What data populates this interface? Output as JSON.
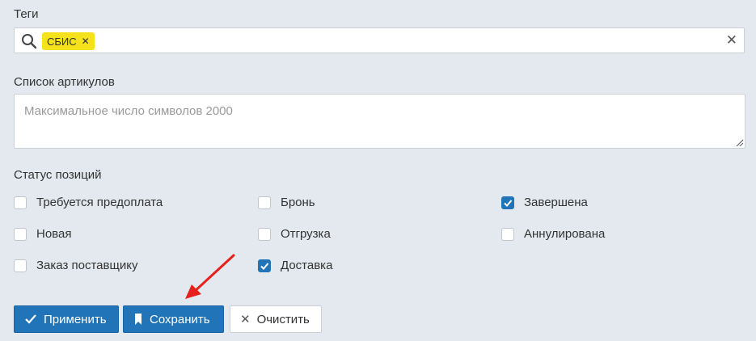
{
  "tags": {
    "label": "Теги",
    "chip": "СБИС",
    "chip_color": "#f5e21a"
  },
  "articles": {
    "label": "Список артикулов",
    "placeholder": "Максимальное число символов 2000"
  },
  "status": {
    "label": "Статус позиций",
    "options": [
      {
        "label": "Требуется предоплата",
        "checked": false
      },
      {
        "label": "Бронь",
        "checked": false
      },
      {
        "label": "Завершена",
        "checked": true
      },
      {
        "label": "Новая",
        "checked": false
      },
      {
        "label": "Отгрузка",
        "checked": false
      },
      {
        "label": "Аннулирована",
        "checked": false
      },
      {
        "label": "Заказ поставщику",
        "checked": false
      },
      {
        "label": "Доставка",
        "checked": true
      }
    ]
  },
  "buttons": {
    "apply": "Применить",
    "save": "Сохранить",
    "clear": "Очистить"
  },
  "colors": {
    "accent": "#2174b8",
    "background": "#e3e9ef",
    "annotation_arrow": "#e5211d"
  },
  "icons": [
    "search-icon",
    "close-icon",
    "check-icon",
    "bookmark-icon",
    "arrow-annotation"
  ]
}
